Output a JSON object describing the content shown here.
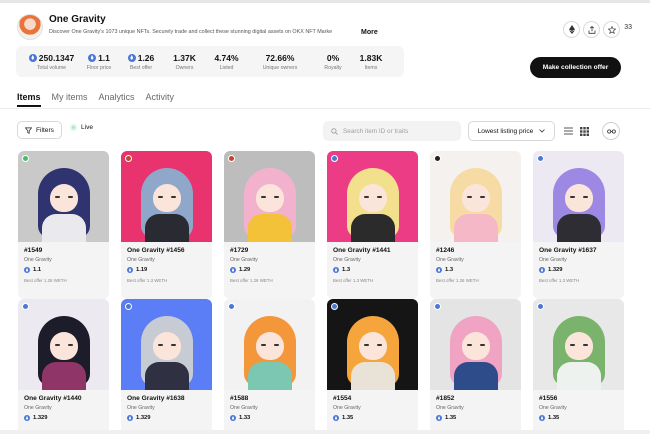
{
  "collection": {
    "name": "One Gravity",
    "description": "Discover One Gravity's 1073 unique NFTs. Securely trade and collect these stunning digital assets on OKX NFT Marke",
    "more_label": "More",
    "favorites_count": "33"
  },
  "stats": [
    {
      "value": "250.1347",
      "label": "Total volume",
      "eth": true
    },
    {
      "value": "1.1",
      "label": "Floor price",
      "eth": true
    },
    {
      "value": "1.26",
      "label": "Best offer",
      "eth": true
    },
    {
      "value": "1.37K",
      "label": "Owners",
      "eth": false
    },
    {
      "value": "4.74%",
      "label": "Listed",
      "eth": false
    },
    {
      "value": "72.66%",
      "label": "Unique owners",
      "eth": false
    },
    {
      "value": "0%",
      "label": "Royalty",
      "eth": false
    },
    {
      "value": "1.83K",
      "label": "Items",
      "eth": false
    }
  ],
  "make_offer_label": "Make collection offer",
  "tabs": [
    {
      "label": "Items",
      "active": true
    },
    {
      "label": "My items",
      "active": false
    },
    {
      "label": "Analytics",
      "active": false
    },
    {
      "label": "Activity",
      "active": false
    }
  ],
  "toolbar": {
    "filters_label": "Filters",
    "live_label": "Live",
    "search_placeholder": "Search item ID or traits",
    "sort_label": "Lowest listing price"
  },
  "colors": {
    "accent": "#111111",
    "eth_blue": "#4b77d6",
    "live_green": "#a7e7c0"
  },
  "cards": [
    {
      "name": "#1549",
      "collection": "One Gravity",
      "price": "1.1",
      "offer": "Best offer 1.26 WETH",
      "bg": "#c9c9c9",
      "hair": "#2f3470",
      "body": "#e9e9ee",
      "badge": "green"
    },
    {
      "name": "One Gravity #1456",
      "collection": "One Gravity",
      "price": "1.19",
      "offer": "Best offer 1.3 WETH",
      "bg": "#e9336f",
      "hair": "#8fa7c9",
      "body": "#2a2a33",
      "badge": "red"
    },
    {
      "name": "#1729",
      "collection": "One Gravity",
      "price": "1.29",
      "offer": "Best offer 1.26 WETH",
      "bg": "#bdbdbd",
      "hair": "#f2b2cd",
      "body": "#f3c238",
      "badge": "red"
    },
    {
      "name": "One Gravity #1441",
      "collection": "One Gravity",
      "price": "1.3",
      "offer": "Best offer 1.3 WETH",
      "bg": "#ec3c86",
      "hair": "#f2e08d",
      "body": "#2b2b2b",
      "badge": "blue"
    },
    {
      "name": "#1246",
      "collection": "One Gravity",
      "price": "1.3",
      "offer": "Best offer 1.26 WETH",
      "bg": "#f5f1ee",
      "hair": "#f6dca4",
      "body": "#f4b8c6",
      "badge": "dark"
    },
    {
      "name": "One Gravity #1637",
      "collection": "One Gravity",
      "price": "1.329",
      "offer": "Best offer 1.3 WETH",
      "bg": "#ece9f3",
      "hair": "#9d89e4",
      "body": "#2d2d33",
      "badge": "blue"
    },
    {
      "name": "One Gravity #1440",
      "collection": "One Gravity",
      "price": "1.329",
      "offer": "",
      "bg": "#eceaf0",
      "hair": "#1d1c2b",
      "body": "#8f3567",
      "badge": "blue"
    },
    {
      "name": "One Gravity #1638",
      "collection": "One Gravity",
      "price": "1.329",
      "offer": "",
      "bg": "#5b7df5",
      "hair": "#c7cbd4",
      "body": "#2f3142",
      "badge": "blue"
    },
    {
      "name": "#1588",
      "collection": "One Gravity",
      "price": "1.33",
      "offer": "",
      "bg": "#f2f2f2",
      "hair": "#f4963a",
      "body": "#7cc7b1",
      "badge": "blue"
    },
    {
      "name": "#1554",
      "collection": "One Gravity",
      "price": "1.35",
      "offer": "",
      "bg": "#151515",
      "hair": "#f5a53b",
      "body": "#e9e2d6",
      "badge": "blue"
    },
    {
      "name": "#1852",
      "collection": "One Gravity",
      "price": "1.35",
      "offer": "",
      "bg": "#e4e4e4",
      "hair": "#f0a3c2",
      "body": "#2f4c8a",
      "badge": "blue"
    },
    {
      "name": "#1556",
      "collection": "One Gravity",
      "price": "1.35",
      "offer": "",
      "bg": "#e8e8e8",
      "hair": "#7ab36c",
      "body": "#eef2ee",
      "badge": "blue"
    }
  ]
}
